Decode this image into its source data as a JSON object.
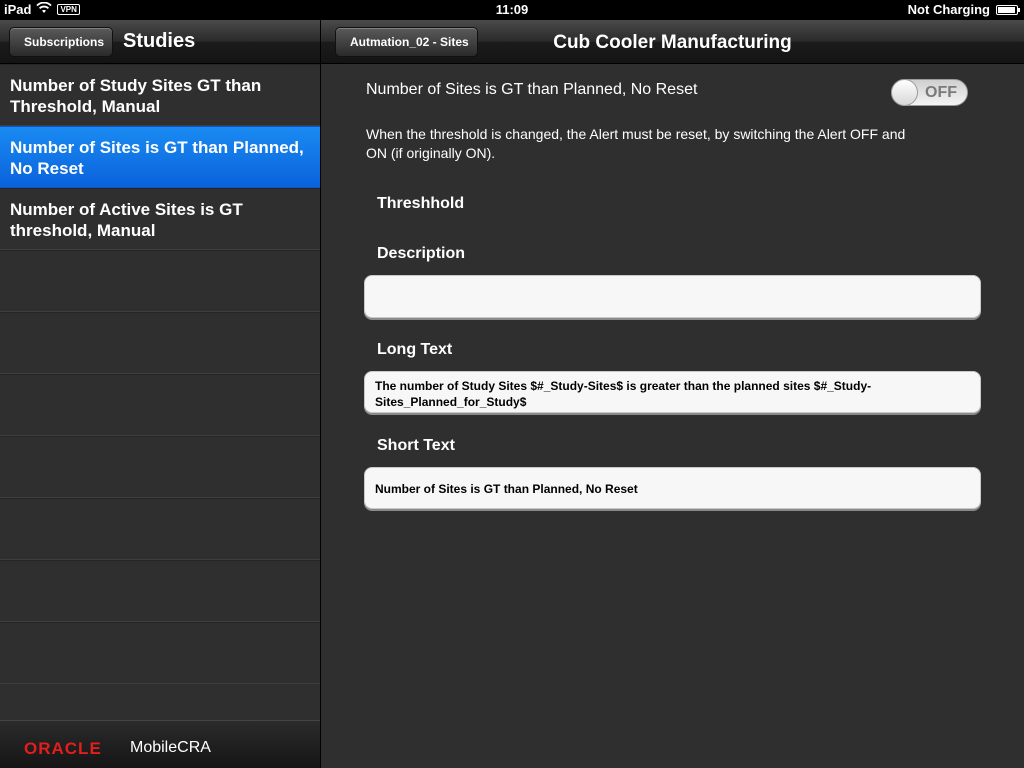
{
  "status_bar": {
    "device": "iPad",
    "vpn": "VPN",
    "time": "11:09",
    "charging": "Not Charging",
    "battery_level": 0.95
  },
  "left_nav": {
    "back_label": "Subscriptions",
    "title": "Studies"
  },
  "list": {
    "items": [
      {
        "label": "Number of Study Sites GT than Threshold, Manual"
      },
      {
        "label": "Number of Sites is GT than Planned, No Reset"
      },
      {
        "label": "Number of Active Sites is GT threshold, Manual"
      }
    ],
    "selected_index": 1
  },
  "footer": {
    "logo_text": "ORACLE",
    "product": "MobileCRA"
  },
  "right_nav": {
    "back_label": "Autmation_02 - Sites",
    "title": "Cub Cooler Manufacturing"
  },
  "detail": {
    "alert_name": "Number of Sites is GT than Planned, No Reset",
    "toggle_state": "OFF",
    "note": "When the threshold is changed, the Alert must be reset, by switching the Alert OFF and ON (if originally ON).",
    "threshold_label": "Threshhold",
    "description_label": "Description",
    "description_value": "",
    "long_text_label": "Long Text",
    "long_text_value": "The number of Study Sites $#_Study-Sites$ is greater than the planned sites $#_Study-Sites_Planned_for_Study$",
    "short_text_label": "Short Text",
    "short_text_value": "Number of Sites is GT than Planned, No Reset"
  },
  "colors": {
    "selection_blue": "#0a6fe6",
    "oracle_red": "#e41d1d",
    "pane_background": "#2f2f2f"
  }
}
